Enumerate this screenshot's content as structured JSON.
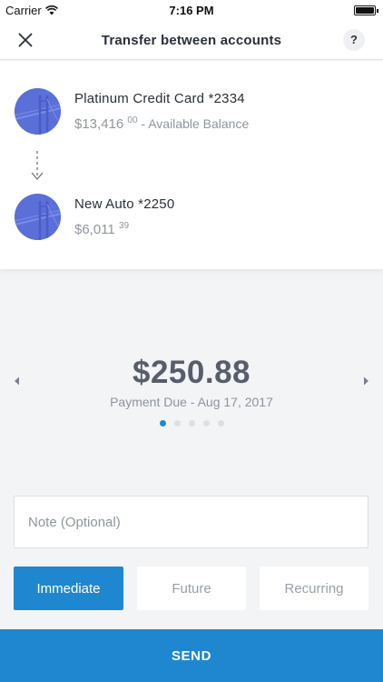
{
  "status_bar": {
    "carrier": "Carrier",
    "wifi_icon": "wifi-icon",
    "time": "7:16 PM",
    "battery_icon": "battery-icon"
  },
  "nav": {
    "close_icon": "close-icon",
    "title": "Transfer between accounts",
    "help_label": "?"
  },
  "from_account": {
    "name": "Platinum Credit Card *2334",
    "balance_main": "$13,416",
    "balance_cents": "00",
    "balance_suffix": " - Available Balance"
  },
  "to_account": {
    "name": "New Auto *2250",
    "balance_main": "$6,011",
    "balance_cents": "39"
  },
  "transfer_direction_icon": "arrow-down-icon",
  "amount": {
    "value": "$250.88",
    "subtitle": "Payment Due - Aug 17, 2017"
  },
  "pager": {
    "total": 5,
    "active_index": 0
  },
  "note": {
    "value": "",
    "placeholder": "Note (Optional)"
  },
  "schedule": {
    "options": [
      "Immediate",
      "Future",
      "Recurring"
    ],
    "selected": "Immediate"
  },
  "send_label": "SEND",
  "colors": {
    "accent": "#1f87cf",
    "avatar": "#5b6fd8",
    "background": "#f3f4f6"
  }
}
